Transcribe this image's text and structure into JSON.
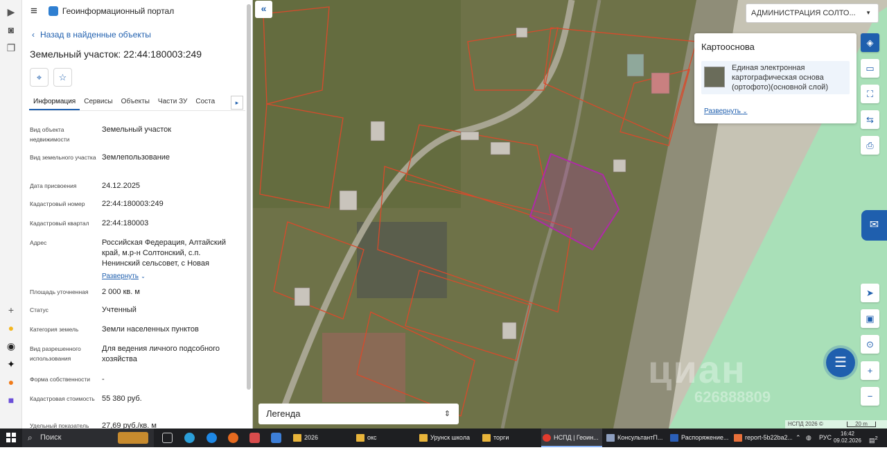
{
  "header": {
    "app_title": "Геоинформационный портал"
  },
  "nav": {
    "back_label": "Назад в найденные объекты"
  },
  "object": {
    "title": "Земельный участок: 22:44:180003:249"
  },
  "tabs": [
    {
      "label": "Информация",
      "active": true
    },
    {
      "label": "Сервисы"
    },
    {
      "label": "Объекты"
    },
    {
      "label": "Части ЗУ"
    },
    {
      "label": "Соста"
    }
  ],
  "properties": [
    {
      "key": "Вид объекта недвижимости",
      "value": "Земельный участок"
    },
    {
      "key": "Вид земельного участка",
      "value": "Землепользование"
    },
    {
      "key": "Дата присвоения",
      "value": "24.12.2025"
    },
    {
      "key": "Кадастровый номер",
      "value": "22:44:180003:249"
    },
    {
      "key": "Кадастровый квартал",
      "value": "22:44:180003"
    },
    {
      "key": "Адрес",
      "value": "Российская Федерация, Алтайский край, м.р-н Солтонский, с.п. Ненинский сельсовет, с Новая",
      "link": "Развернуть"
    },
    {
      "key": "Площадь уточненная",
      "value": "2 000 кв. м"
    },
    {
      "key": "Статус",
      "value": "Учтенный"
    },
    {
      "key": "Категория земель",
      "value": "Земли населенных пунктов"
    },
    {
      "key": "Вид разрешенного использования",
      "value": "Для ведения личного подсобного хозяйства"
    },
    {
      "key": "Форма собственности",
      "value": "-"
    },
    {
      "key": "Кадастровая стоимость",
      "value": "55 380 руб."
    },
    {
      "key": "Удельный показатель",
      "value": "27,69 руб./кв. м"
    }
  ],
  "map": {
    "admin_select": "АДМИНИСТРАЦИЯ СОЛТО...",
    "basemap_title": "Картооснова",
    "basemap_item": "Единая электронная картографическая основа (ортофото)(основной слой)",
    "basemap_expand": "Развернуть",
    "legend_label": "Легенда",
    "copyright": "НСПД 2026 ©",
    "scale_label": "20 m",
    "watermark": "циан",
    "watermark_phone": "626888809",
    "colors": {
      "accent": "#1f5fae",
      "parcel_line": "#d94a2b",
      "selected_parcel": "#b02aa8"
    }
  },
  "taskbar": {
    "search_label": "Поиск",
    "apps": [
      "2026",
      "окс",
      "Урунск школа",
      "торги",
      "НСПД | Геоин...",
      "КонсультантП...",
      "Распоряжение...",
      "report-5b22ba2..."
    ],
    "lang": "РУС",
    "time": "16:42",
    "date": "09.02.2026",
    "notifications": "2"
  }
}
